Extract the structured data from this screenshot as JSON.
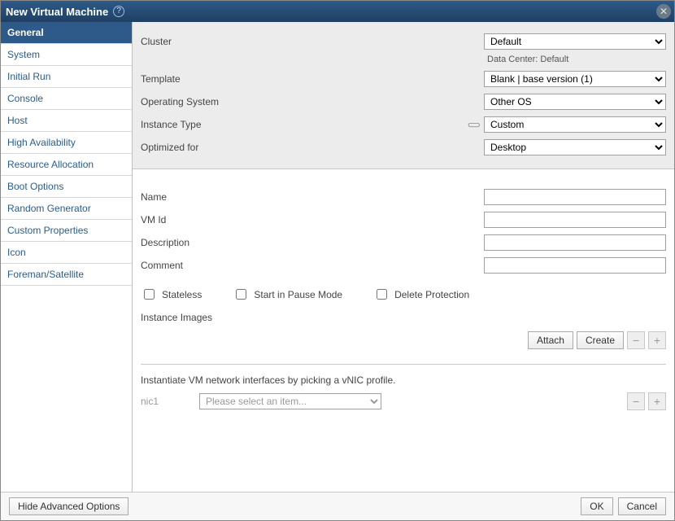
{
  "dialog": {
    "title": "New Virtual Machine",
    "help_icon": "?",
    "close_icon": "✕"
  },
  "sidebar": {
    "items": [
      {
        "label": "General",
        "selected": true
      },
      {
        "label": "System"
      },
      {
        "label": "Initial Run"
      },
      {
        "label": "Console"
      },
      {
        "label": "Host"
      },
      {
        "label": "High Availability"
      },
      {
        "label": "Resource Allocation"
      },
      {
        "label": "Boot Options"
      },
      {
        "label": "Random Generator"
      },
      {
        "label": "Custom Properties"
      },
      {
        "label": "Icon"
      },
      {
        "label": "Foreman/Satellite"
      }
    ]
  },
  "form": {
    "cluster": {
      "label": "Cluster",
      "value": "Default",
      "sub": "Data Center: Default"
    },
    "template": {
      "label": "Template",
      "value": "Blank | base version (1)"
    },
    "os": {
      "label": "Operating System",
      "value": "Other OS"
    },
    "instance_type": {
      "label": "Instance Type",
      "value": "Custom"
    },
    "optimized": {
      "label": "Optimized for",
      "value": "Desktop"
    },
    "name": {
      "label": "Name",
      "value": ""
    },
    "vmid": {
      "label": "VM Id",
      "value": ""
    },
    "description": {
      "label": "Description",
      "value": ""
    },
    "comment": {
      "label": "Comment",
      "value": ""
    },
    "stateless": {
      "label": "Stateless"
    },
    "pause": {
      "label": "Start in Pause Mode"
    },
    "delete_protect": {
      "label": "Delete Protection"
    },
    "instance_images": {
      "label": "Instance Images"
    },
    "attach": {
      "label": "Attach"
    },
    "create": {
      "label": "Create"
    },
    "nic_hint": "Instantiate VM network interfaces by picking a vNIC profile.",
    "nic1": {
      "label": "nic1",
      "placeholder": "Please select an item..."
    }
  },
  "footer": {
    "advanced": "Hide Advanced Options",
    "ok": "OK",
    "cancel": "Cancel"
  },
  "glyphs": {
    "minus": "−",
    "plus": "+",
    "chain": "⊂⊃"
  }
}
